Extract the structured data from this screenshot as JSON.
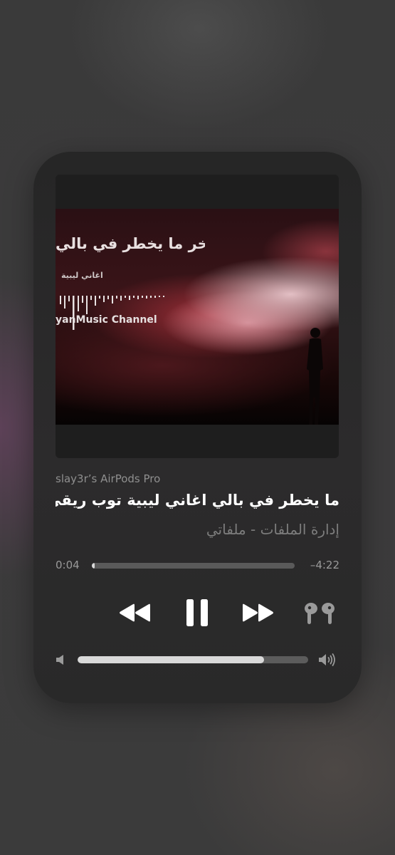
{
  "now_playing": {
    "artwork": {
      "overlay_title": "اخر ما يخطر في بالي",
      "overlay_subtitle": "اغاني ليبية",
      "overlay_channel": "yanMusic Channel"
    },
    "audio_route": "slay3r’s AirPods Pro",
    "title": "ما يخطر في بالي  اغاني ليبية توب  ريقي",
    "subtitle": "إدارة الملفات - ملفاتي",
    "elapsed": "0:04",
    "remaining": "–4:22",
    "progress": 0.015,
    "volume": 0.81
  },
  "controls": {
    "rewind_icon": "rewind-icon",
    "play_pause_icon": "pause-icon",
    "forward_icon": "fast-forward-icon",
    "output_icon": "airpods-pro-icon",
    "volume_low_icon": "speaker-low-icon",
    "volume_high_icon": "speaker-high-icon"
  },
  "colors": {
    "accent": "#ffffff",
    "secondary_text": "#8f8f8f",
    "track": "#5a5a5a",
    "fill": "#d8d8d8"
  }
}
